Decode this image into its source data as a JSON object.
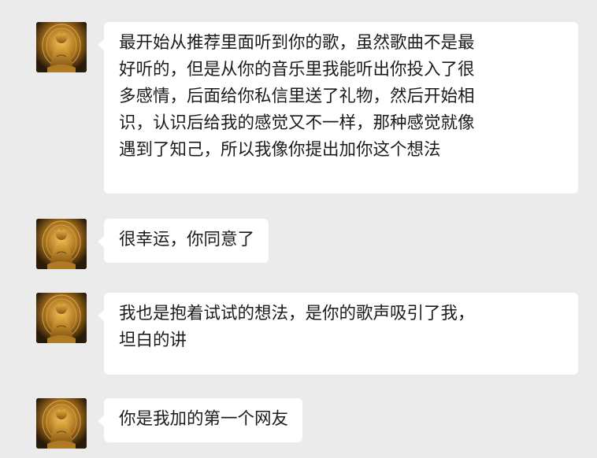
{
  "chat": {
    "messages": [
      {
        "avatar_icon": "golden-buddha-avatar-icon",
        "text": "最开始从推荐里面听到你的歌，虽然歌曲不是最\n好听的，但是从你的音乐里我能听出你投入了很\n多感情，后面给你私信里送了礼物，然后开始相\n识，认识后给我的感觉又不一样，那种感觉就像\n遇到了知己，所以我像你提出加你这个想法"
      },
      {
        "avatar_icon": "golden-buddha-avatar-icon",
        "text": "很幸运，你同意了"
      },
      {
        "avatar_icon": "golden-buddha-avatar-icon",
        "text": "我也是抱着试试的想法，是你的歌声吸引了我，\n坦白的讲"
      },
      {
        "avatar_icon": "golden-buddha-avatar-icon",
        "text": "你是我加的第一个网友"
      }
    ]
  },
  "colors": {
    "background": "#ebebeb",
    "bubble": "#ffffff",
    "text": "#1b1b1b",
    "avatar_gold": "#c8962e",
    "avatar_dark": "#2a1f0e"
  }
}
